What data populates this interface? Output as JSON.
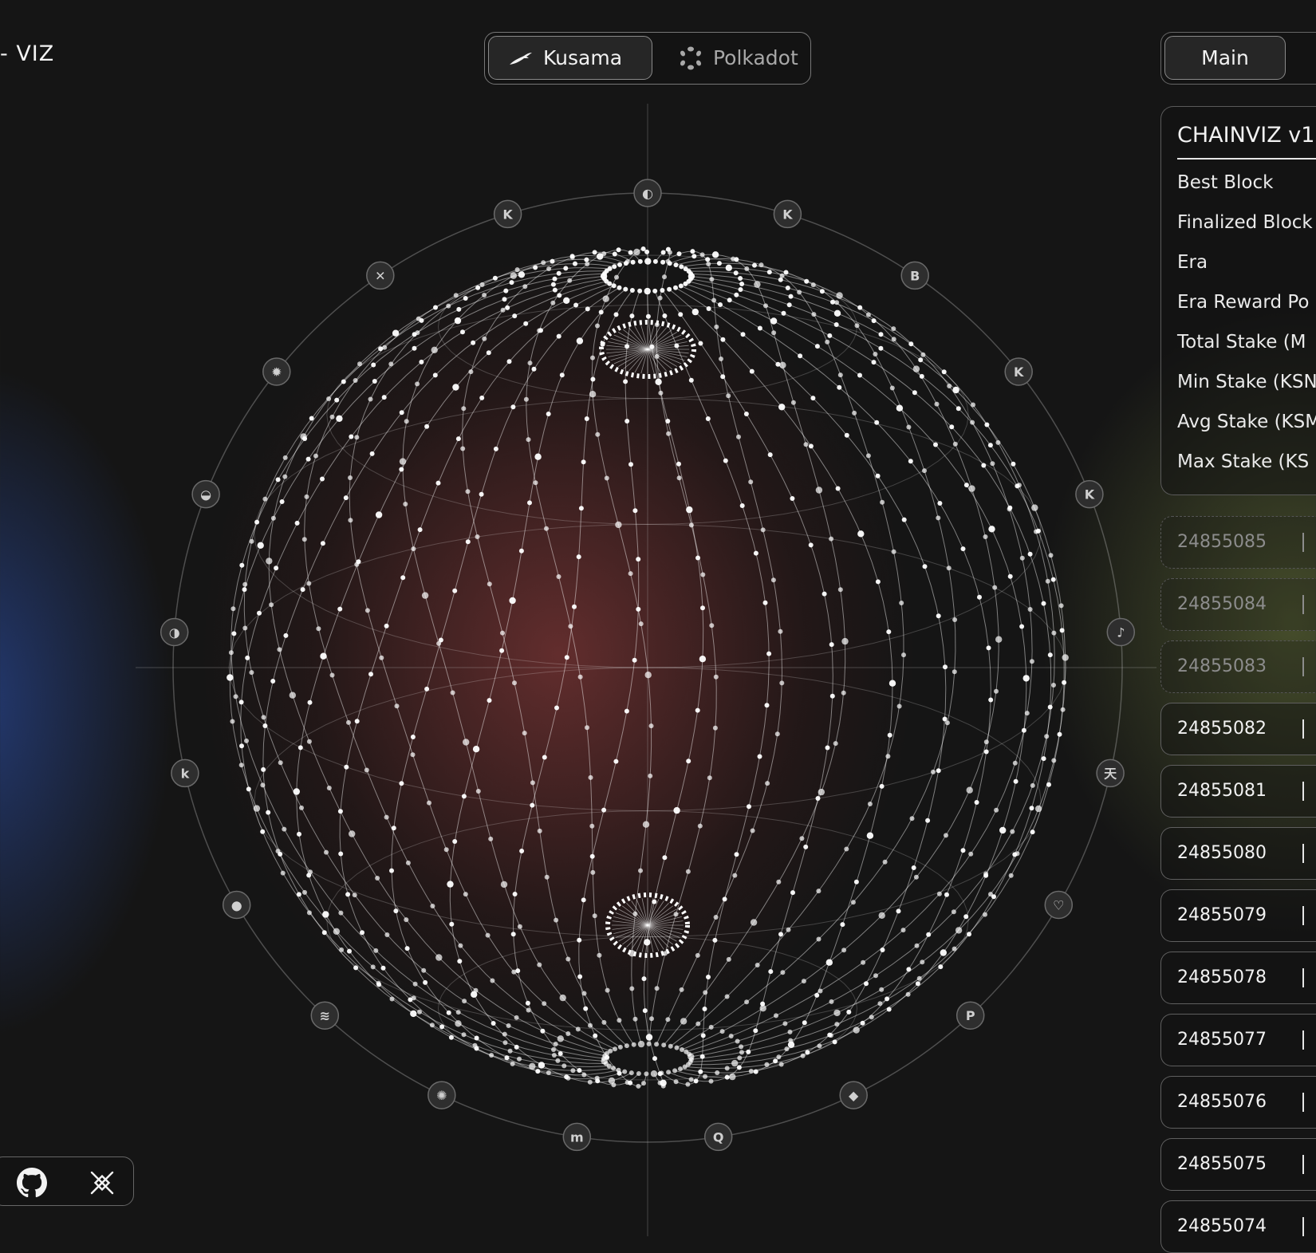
{
  "app": {
    "title": "- VIZ"
  },
  "network_switch": {
    "options": [
      {
        "label": "Kusama",
        "icon": "kusama-bird-icon",
        "active": true
      },
      {
        "label": "Polkadot",
        "icon": "polkadot-ring-icon",
        "active": false
      }
    ]
  },
  "view_tabs": {
    "main_label": "Main"
  },
  "stats_panel": {
    "title": "CHAINVIZ v1.",
    "labels": [
      "Best Block",
      "Finalized Block",
      "Era",
      "Era Reward Po",
      "Total Stake (M",
      "Min Stake (KSN",
      "Avg Stake (KSM",
      "Max Stake (KS"
    ]
  },
  "blocks": [
    {
      "number": "24855085",
      "status": "pending"
    },
    {
      "number": "24855084",
      "status": "pending"
    },
    {
      "number": "24855083",
      "status": "pending"
    },
    {
      "number": "24855082",
      "status": "finalized"
    },
    {
      "number": "24855081",
      "status": "finalized"
    },
    {
      "number": "24855080",
      "status": "finalized"
    },
    {
      "number": "24855079",
      "status": "finalized"
    },
    {
      "number": "24855078",
      "status": "finalized"
    },
    {
      "number": "24855077",
      "status": "finalized"
    },
    {
      "number": "24855076",
      "status": "finalized"
    },
    {
      "number": "24855075",
      "status": "finalized"
    },
    {
      "number": "24855074",
      "status": "finalized"
    }
  ],
  "parachain_icons": [
    {
      "name": "moonbeam-icon",
      "glyph": "◐"
    },
    {
      "name": "karura-icon",
      "glyph": "K"
    },
    {
      "name": "bifrost-icon",
      "glyph": "B"
    },
    {
      "name": "kintsugi-icon",
      "glyph": "K"
    },
    {
      "name": "kilt-icon",
      "glyph": "K"
    },
    {
      "name": "sora-icon",
      "glyph": "♪"
    },
    {
      "name": "tinkernet-icon",
      "glyph": "天"
    },
    {
      "name": "picasso-icon",
      "glyph": "♡"
    },
    {
      "name": "parallel-icon",
      "glyph": "P"
    },
    {
      "name": "crust-icon",
      "glyph": "◆"
    },
    {
      "name": "quartz-icon",
      "glyph": "Q"
    },
    {
      "name": "mangata-icon",
      "glyph": "m"
    },
    {
      "name": "crab-icon",
      "glyph": "✺"
    },
    {
      "name": "heiko-icon",
      "glyph": "≋"
    },
    {
      "name": "shiden-icon",
      "glyph": "●"
    },
    {
      "name": "kabocha-icon",
      "glyph": "k"
    },
    {
      "name": "calamari-icon",
      "glyph": "◑"
    },
    {
      "name": "altair-icon",
      "glyph": "◒"
    },
    {
      "name": "sunflower-icon",
      "glyph": "✹"
    },
    {
      "name": "genshiro-icon",
      "glyph": "✕"
    },
    {
      "name": "robonomics-icon",
      "glyph": "K"
    }
  ],
  "social": {
    "github_icon": "github-icon",
    "kiad_icon": "kiad-icon"
  }
}
